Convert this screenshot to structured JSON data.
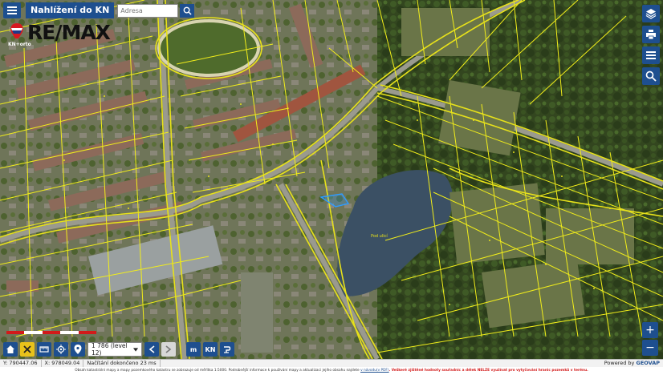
{
  "header": {
    "title": "Nahlížení do KN",
    "search_placeholder": "Adresa"
  },
  "logo": {
    "text": "RE/MAX",
    "sub": "KN+orto"
  },
  "map": {
    "pond_label": "Pod ulicí",
    "colors": {
      "parcel_line": "#f2ee1a",
      "road": "#e8e21a",
      "selected": "#2e9bff",
      "vegetation": "#2f4a1e",
      "water": "#3b5064"
    }
  },
  "toolbar": {
    "scale_select": "1 786 (level 12)",
    "m_button": "m",
    "kn_button": "KN",
    "icons": [
      "home-icon",
      "close-icon",
      "ruler-icon",
      "locate-icon",
      "pin-icon",
      "arrow-left-icon",
      "arrow-right-icon",
      "info-icon"
    ]
  },
  "zoom": {
    "in": "+",
    "out": "−"
  },
  "status": {
    "y": "Y: 790447.06",
    "x": "X: 978049.04",
    "loading": "Načítání dokončeno 23 ms",
    "powered_prefix": "Powered by ",
    "powered_brand": "GEOVAP"
  },
  "footer": {
    "text1": "Obsah katastrální mapy a mapy pozemkového katastru se zobrazuje od měřítka 1:5000. Podrobnější informace k používání mapy a aktualizaci jejího obsahu najdete ",
    "link": "v návodu(v PDF)",
    "warn": ". Veškeré zjištěné hodnoty souřadnic a délek NELZE využívat pro vytyčování hranic pozemků v terénu."
  }
}
